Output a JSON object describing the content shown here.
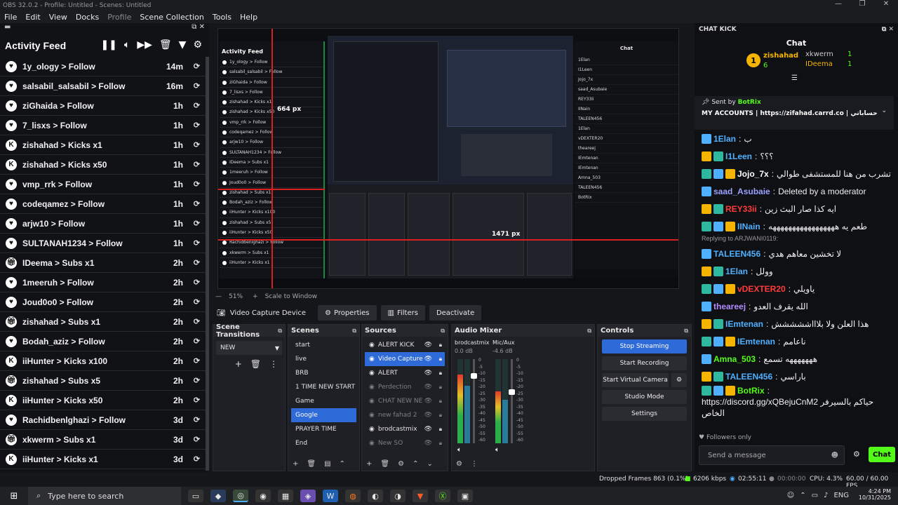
{
  "window": {
    "title": "OBS 32.0.2 - Profile: Untitled - Scenes: Untitled"
  },
  "menu": [
    "File",
    "Edit",
    "View",
    "Docks",
    "Profile",
    "Scene Collection",
    "Tools",
    "Help"
  ],
  "activity_feed": {
    "title": "Activity Feed",
    "items": [
      {
        "icon": "heart",
        "text": "1y_ology > Follow",
        "time": "14m"
      },
      {
        "icon": "heart",
        "text": "salsabil_salsabil > Follow",
        "time": "16m"
      },
      {
        "icon": "heart",
        "text": "ziGhaida > Follow",
        "time": "1h"
      },
      {
        "icon": "heart",
        "text": "7_lisxs > Follow",
        "time": "1h"
      },
      {
        "icon": "kick",
        "text": "zishahad > Kicks x1",
        "time": "1h"
      },
      {
        "icon": "kick",
        "text": "zishahad > Kicks x50",
        "time": "1h"
      },
      {
        "icon": "heart",
        "text": "vmp_rrk > Follow",
        "time": "1h"
      },
      {
        "icon": "heart",
        "text": "codeqamez > Follow",
        "time": "1h"
      },
      {
        "icon": "heart",
        "text": "arjw10 > Follow",
        "time": "1h"
      },
      {
        "icon": "heart",
        "text": "SULTANAH1234 > Follow",
        "time": "1h"
      },
      {
        "icon": "gift",
        "text": "IDeema > Subs x1",
        "time": "2h"
      },
      {
        "icon": "heart",
        "text": "1meeruh > Follow",
        "time": "2h"
      },
      {
        "icon": "heart",
        "text": "Joud0o0 > Follow",
        "time": "2h"
      },
      {
        "icon": "gift",
        "text": "zishahad > Subs x1",
        "time": "2h"
      },
      {
        "icon": "heart",
        "text": "Bodah_aziz > Follow",
        "time": "2h"
      },
      {
        "icon": "kick",
        "text": "iiHunter > Kicks x100",
        "time": "2h"
      },
      {
        "icon": "gift",
        "text": "zishahad > Subs x5",
        "time": "2h"
      },
      {
        "icon": "kick",
        "text": "iiHunter > Kicks x50",
        "time": "2h"
      },
      {
        "icon": "heart",
        "text": "Rachidbenlghazi > Follow",
        "time": "3d"
      },
      {
        "icon": "gift",
        "text": "xkwerm > Subs x1",
        "time": "3d"
      },
      {
        "icon": "kick",
        "text": "iiHunter > Kicks x1",
        "time": "3d"
      }
    ]
  },
  "preview": {
    "label_664": "664 px",
    "label_1471": "1471 px",
    "mini_feed_title": "Activity Feed",
    "mini_chat_title": "Chat"
  },
  "zoom": {
    "percent": "51%",
    "mode": "Scale to Window"
  },
  "source_bar": {
    "source": "Video Capture Device",
    "properties": "Properties",
    "filters": "Filters",
    "deactivate": "Deactivate"
  },
  "scene_transitions": {
    "title": "Scene Transitions",
    "value": "NEW"
  },
  "scenes": {
    "title": "Scenes",
    "items": [
      "start",
      "live",
      "BRB",
      "1 TIME NEW START",
      "Game",
      "Google",
      "PRAYER TIME",
      "End"
    ],
    "selected": "Google"
  },
  "sources": {
    "title": "Sources",
    "items": [
      {
        "name": "ALERT KICK",
        "dim": false,
        "sel": false
      },
      {
        "name": "Video Capture",
        "dim": false,
        "sel": true
      },
      {
        "name": "ALERT",
        "dim": false,
        "sel": false
      },
      {
        "name": "Perdection",
        "dim": true,
        "sel": false
      },
      {
        "name": "CHAT NEW NE",
        "dim": true,
        "sel": false
      },
      {
        "name": "new fahad 2",
        "dim": true,
        "sel": false
      },
      {
        "name": "brodcastmix",
        "dim": false,
        "sel": false
      },
      {
        "name": "New SO",
        "dim": true,
        "sel": false
      }
    ]
  },
  "audio_mixer": {
    "title": "Audio Mixer",
    "channels": [
      {
        "name": "brodcastmix",
        "db": "0.0 dB",
        "level": 0.82
      },
      {
        "name": "Mic/Aux",
        "db": "-4.6 dB",
        "level": 0.62
      }
    ],
    "scale": [
      "0",
      "-5",
      "-10",
      "-15",
      "-20",
      "-25",
      "-30",
      "-35",
      "-40",
      "-45",
      "-50",
      "-55",
      "-60"
    ]
  },
  "controls": {
    "title": "Controls",
    "stop_streaming": "Stop Streaming",
    "start_recording": "Start Recording",
    "virtual_camera": "Start Virtual Camera",
    "studio_mode": "Studio Mode",
    "settings": "Settings"
  },
  "chat": {
    "dock_title": "CHAT KICK",
    "title": "Chat",
    "top": [
      {
        "name": "zishahad",
        "count": "6"
      },
      {
        "name": "xkwerm",
        "count": "1"
      },
      {
        "name": "IDeema",
        "count": "1"
      }
    ],
    "pinned_by": "Sent by",
    "pinned_user": "BotRix",
    "pinned_text": "MY ACCOUNTS | https://zifahad.carrd.co | حساباتي",
    "messages": [
      {
        "user": "1Elan",
        "color": "#4fb0ff",
        "text": "ب"
      },
      {
        "user": "I1Leen",
        "color": "#4fb0ff",
        "text": "؟؟؟"
      },
      {
        "user": "Jojo_7x",
        "color": "#ffffff",
        "text": "تشرب من هنا للمستشفى طوالي"
      },
      {
        "user": "saad_Asubaie",
        "color": "#9aa0ff",
        "text": "Deleted by a moderator"
      },
      {
        "user": "REY33ii",
        "color": "#ff3b3b",
        "text": "ايه كذا صار البث زين"
      },
      {
        "user": "IINain",
        "color": "#4fb0ff",
        "text": "طعم يه هههههههههههههههههه"
      },
      {
        "user": "TALEEN456",
        "color": "#4fb0ff",
        "text": "لا تخشين معاهم هدي"
      },
      {
        "user": "1Elan",
        "color": "#4fb0ff",
        "text": "وولل"
      },
      {
        "user": "vDEXTER20",
        "color": "#ff3b3b",
        "text": "ياويلي"
      },
      {
        "user": "theareej",
        "color": "#b48cff",
        "text": "الله يقرف العدو"
      },
      {
        "user": "IEmtenan",
        "color": "#4fb0ff",
        "text": "هذا العلن ولا بلاااششششش"
      },
      {
        "user": "IEmtenan",
        "color": "#4fb0ff",
        "text": "ناعامم"
      },
      {
        "user": "Amna_503",
        "color": "#53fc18",
        "text": "هههههههه تسمع"
      },
      {
        "user": "TALEEN456",
        "color": "#4fb0ff",
        "text": "باراسي"
      },
      {
        "user": "BotRix",
        "color": "#53fc18",
        "text": "https://discord.gg/xQBejuCnM2 حياكم بالسيرفر الخاص"
      }
    ],
    "reply_note": "Replying to ARJWANI0119:",
    "followers_only": "Followers only",
    "input_placeholder": "Send a message",
    "send_label": "Chat"
  },
  "status": {
    "dropped": "Dropped Frames 863 (0.1%)",
    "kbps": "6206 kbps",
    "stream_time": "02:55:11",
    "rec_time": "00:00:00",
    "cpu": "CPU: 4.3%",
    "fps": "60.00 / 60.00 FPS"
  },
  "taskbar": {
    "search": "Type here to search",
    "time": "4:24 PM",
    "date": "10/31/2025"
  },
  "colors": {
    "accent": "#2f6ad9",
    "kick_green": "#53fc18",
    "guide_red": "#d82020"
  }
}
